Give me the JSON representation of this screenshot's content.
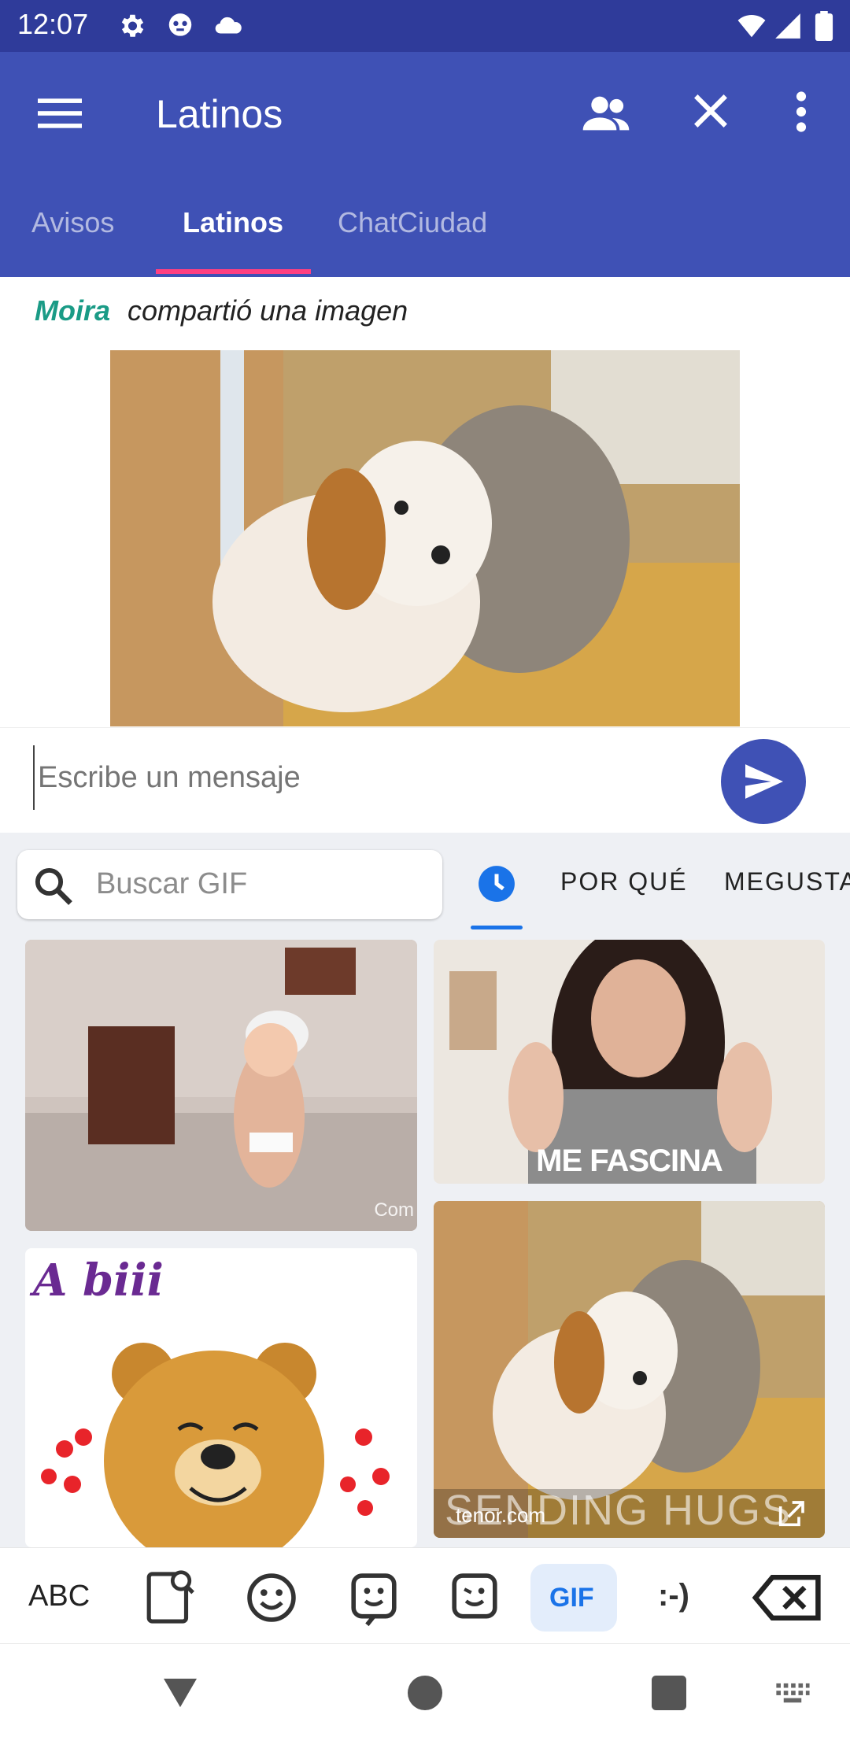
{
  "status_bar": {
    "time": "12:07"
  },
  "app_bar": {
    "title": "Latinos"
  },
  "tabs": [
    {
      "label": "Avisos"
    },
    {
      "label": "Latinos"
    },
    {
      "label": "ChatCiudad"
    }
  ],
  "message": {
    "author": "Moira",
    "text": "compartió una imagen"
  },
  "composer": {
    "placeholder": "Escribe un mensaje"
  },
  "gif_panel": {
    "search_placeholder": "Buscar GIF",
    "categories": [
      "POR QUÉ",
      "MEGUSTA"
    ],
    "gifs": [
      {
        "overlay": "Com"
      },
      {
        "overlay": "ME FASCINA"
      },
      {
        "overlay": "A biii"
      },
      {
        "overlay": "SENDING HUGS",
        "source": "tenor.com"
      }
    ]
  },
  "keyboard_toolbar": {
    "abc_label": "ABC",
    "gif_label": "GIF",
    "emoticon_label": ":-)"
  },
  "colors": {
    "primary": "#3f51b5",
    "status_bar": "#2f3b9a",
    "accent": "#ff4081",
    "author": "#1a9b86",
    "gif_tab": "#1a73e8"
  }
}
